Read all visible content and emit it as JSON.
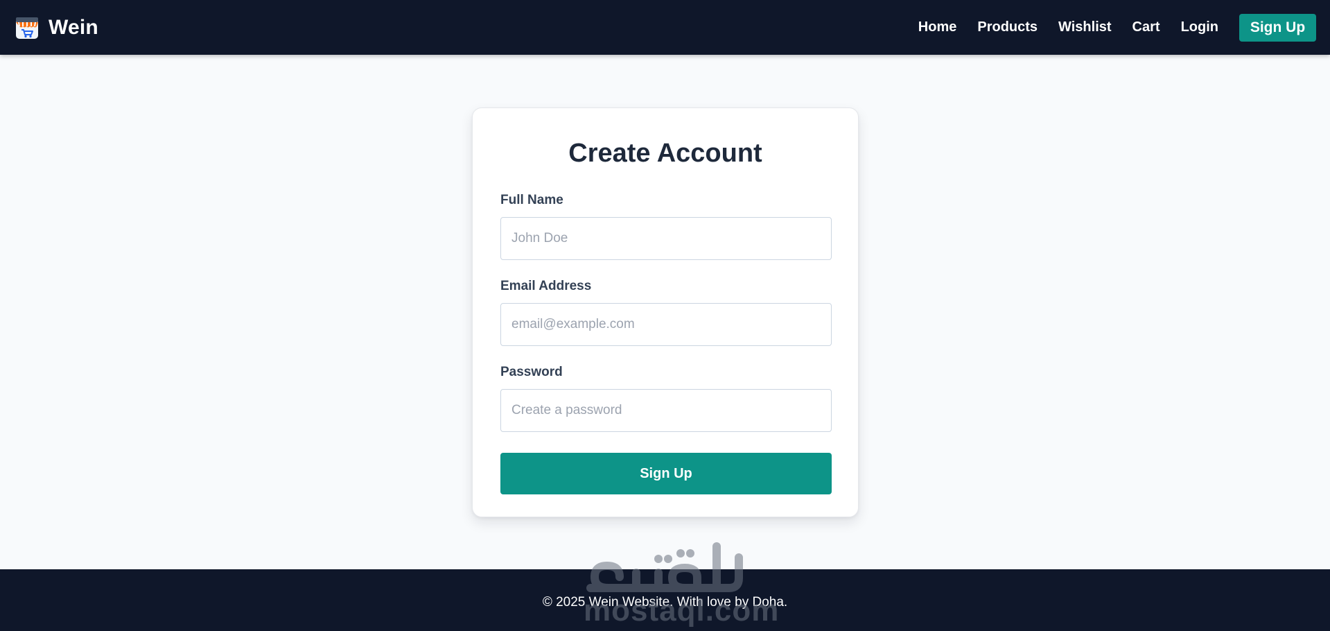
{
  "nav": {
    "brand": "Wein",
    "links": [
      "Home",
      "Products",
      "Wishlist",
      "Cart",
      "Login"
    ],
    "signup": "Sign Up"
  },
  "form": {
    "title": "Create Account",
    "full_name": {
      "label": "Full Name",
      "placeholder": "John Doe",
      "value": ""
    },
    "email": {
      "label": "Email Address",
      "placeholder": "email@example.com",
      "value": ""
    },
    "password": {
      "label": "Password",
      "placeholder": "Create a password",
      "value": ""
    },
    "submit": "Sign Up"
  },
  "footer": {
    "text": "© 2025 Wein Website. With love by Doha."
  },
  "watermark": {
    "arabic": "مستقل",
    "latin": "mostaql.com"
  },
  "colors": {
    "nav_bg": "#0f172a",
    "accent": "#0d9488",
    "page_bg": "#f8fafc",
    "footer_bg": "#0f172a"
  }
}
